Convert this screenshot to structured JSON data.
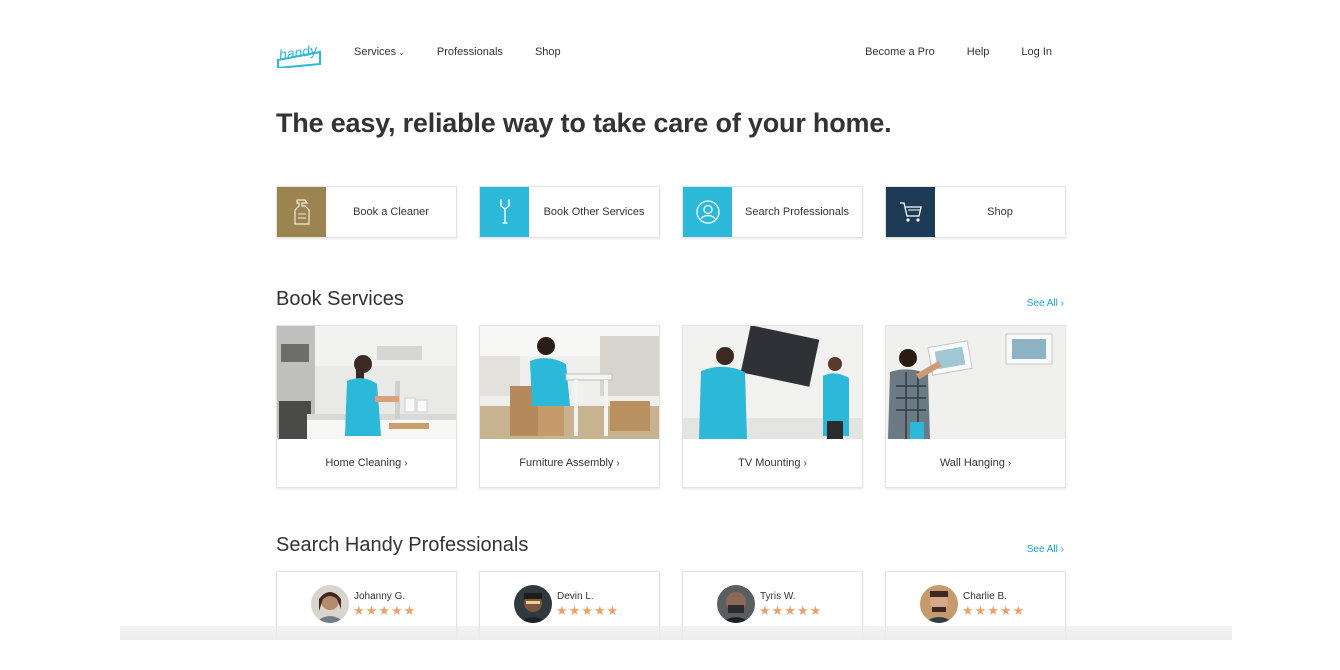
{
  "header": {
    "logo_text": "handy",
    "nav_left": [
      {
        "label": "Services",
        "has_dropdown": true
      },
      {
        "label": "Professionals"
      },
      {
        "label": "Shop"
      }
    ],
    "nav_right": [
      {
        "label": "Become a Pro"
      },
      {
        "label": "Help"
      },
      {
        "label": "Log In"
      }
    ]
  },
  "hero": {
    "title": "The easy, reliable way to take care of your home."
  },
  "actions": [
    {
      "label": "Book a Cleaner",
      "icon": "spray-bottle-icon",
      "color": "#9b8450"
    },
    {
      "label": "Book Other Services",
      "icon": "wrench-icon",
      "color": "#2bb8d9"
    },
    {
      "label": "Search Professionals",
      "icon": "person-icon",
      "color": "#2bb8d9"
    },
    {
      "label": "Shop",
      "icon": "cart-icon",
      "color": "#1d3a57"
    }
  ],
  "book_services": {
    "title": "Book Services",
    "see_all": "See All",
    "items": [
      {
        "label": "Home Cleaning"
      },
      {
        "label": "Furniture Assembly"
      },
      {
        "label": "TV Mounting"
      },
      {
        "label": "Wall Hanging"
      }
    ]
  },
  "professionals": {
    "title": "Search Handy Professionals",
    "see_all": "See All",
    "items": [
      {
        "name": "Johanny G.",
        "rating": 5
      },
      {
        "name": "Devin L.",
        "rating": 5
      },
      {
        "name": "Tyris W.",
        "rating": 5
      },
      {
        "name": "Charlie B.",
        "rating": 5
      }
    ]
  },
  "colors": {
    "accent": "#1a9fcc",
    "star": "#e8a36b",
    "cleaner_tile": "#9b8450",
    "services_tile": "#2bb8d9",
    "shop_tile": "#1d3a57"
  }
}
